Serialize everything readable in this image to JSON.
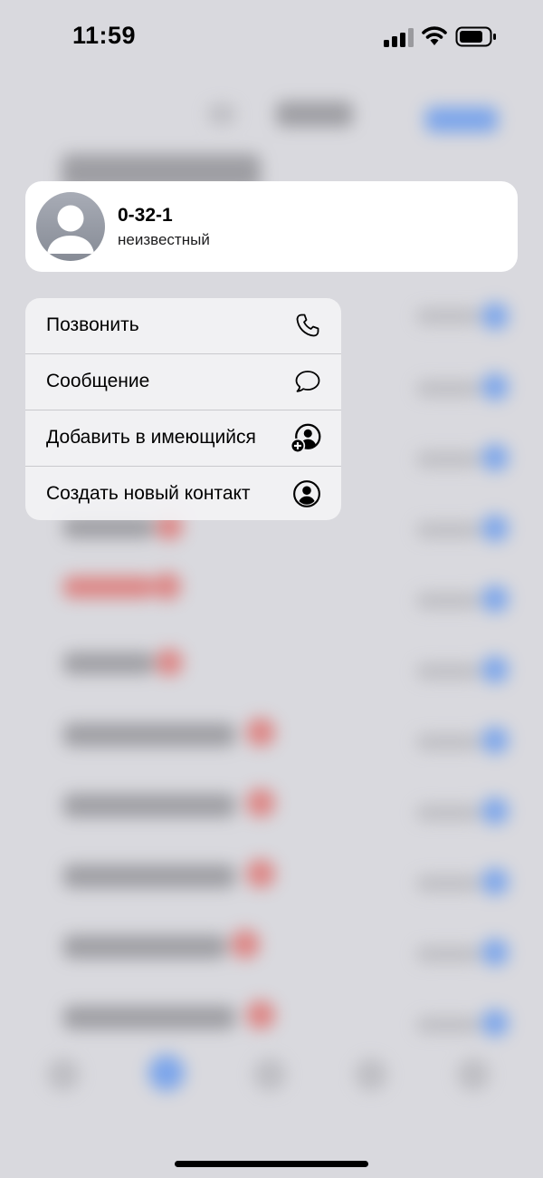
{
  "status_bar": {
    "time": "11:59"
  },
  "contact": {
    "name": "0-32-1",
    "subtitle": "неизвестный",
    "avatar_icon": "person-silhouette-icon"
  },
  "menu": {
    "items": [
      {
        "label": "Позвонить",
        "icon": "phone-icon"
      },
      {
        "label": "Сообщение",
        "icon": "message-bubble-icon"
      },
      {
        "label": "Добавить в имеющийся",
        "icon": "add-to-contact-icon"
      },
      {
        "label": "Создать новый контакт",
        "icon": "person-circle-icon"
      }
    ]
  },
  "colors": {
    "background": "#d9d9de",
    "card": "#ffffff",
    "menu": "#f2f2f4",
    "accent_blue": "#2f7bf5",
    "missed_red": "#e0403a"
  }
}
